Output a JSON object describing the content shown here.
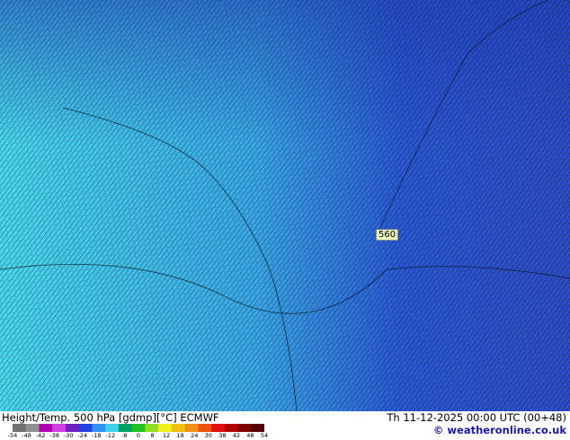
{
  "map": {
    "contour_label": "560",
    "colors": {
      "west": "#4ad8ee",
      "center": "#3aa8e8",
      "east": "#2f4ec8",
      "northeast": "#2a5ad6",
      "symbols": "#000000"
    }
  },
  "footer": {
    "title": "Height/Temp. 500 hPa [gdmp][°C] ECMWF",
    "valid": "Th 11-12-2025 00:00 UTC (00+48)",
    "credit": "© weatheronline.co.uk",
    "scale_ticks": [
      "-54",
      "-48",
      "-42",
      "-38",
      "-30",
      "-24",
      "-18",
      "-12",
      "-8",
      "0",
      "8",
      "12",
      "18",
      "24",
      "30",
      "38",
      "42",
      "48",
      "54"
    ],
    "scale_colors": [
      "#707070",
      "#909090",
      "#b000b0",
      "#d040e0",
      "#7020c0",
      "#2040e0",
      "#3090f0",
      "#40d0f0",
      "#00a060",
      "#20c020",
      "#90e020",
      "#f0f020",
      "#f0c010",
      "#f09010",
      "#f05010",
      "#e01010",
      "#b00000",
      "#800000",
      "#500000"
    ]
  }
}
